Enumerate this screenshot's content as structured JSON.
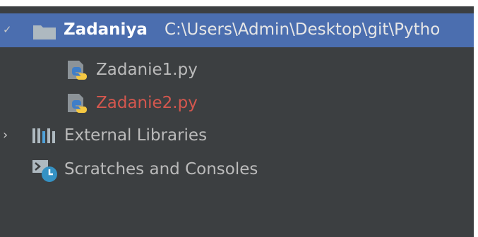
{
  "project_tree": {
    "root": {
      "name": "Zadaniya",
      "path": "C:\\Users\\Admin\\Desktop\\git\\Pytho",
      "expanded": true,
      "icon": "folder-icon"
    },
    "files": [
      {
        "name": "Zadanie1.py",
        "icon": "python-file-icon",
        "status": "unchanged"
      },
      {
        "name": "Zadanie2.py",
        "icon": "python-file-icon",
        "status": "unversioned",
        "status_color": "#d4574e"
      }
    ],
    "external_libraries": {
      "label": "External Libraries",
      "icon": "libraries-icon",
      "expanded": false
    },
    "scratches": {
      "label": "Scratches and Consoles",
      "icon": "scratches-icon"
    }
  },
  "colors": {
    "background": "#3c3f41",
    "selection": "#4b6eaf",
    "text": "#bbbbbb",
    "unversioned": "#d4574e"
  }
}
